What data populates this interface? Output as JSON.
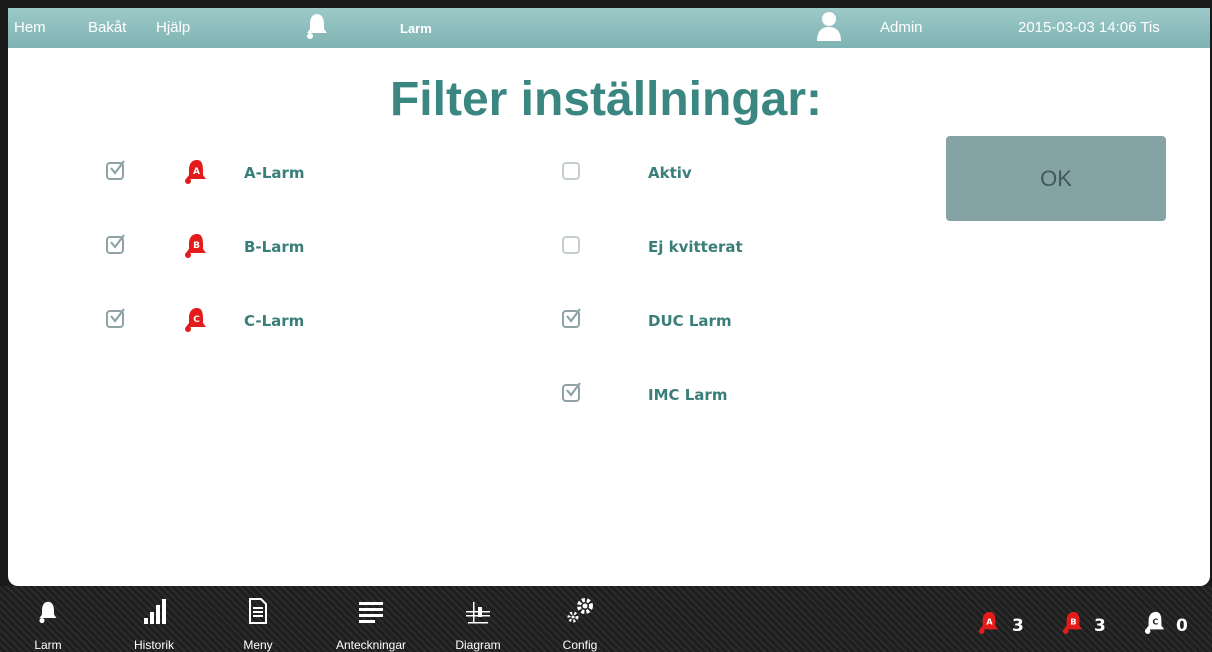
{
  "topbar": {
    "home": "Hem",
    "back": "Bakåt",
    "help": "Hjälp",
    "current": "Larm",
    "user": "Admin",
    "datetime": "2015-03-03 14:06 Tis"
  },
  "page": {
    "title": "Filter inställningar:"
  },
  "left_filters": [
    {
      "label": "A-Larm",
      "badge": "A",
      "checked": true
    },
    {
      "label": "B-Larm",
      "badge": "B",
      "checked": true
    },
    {
      "label": "C-Larm",
      "badge": "C",
      "checked": true
    }
  ],
  "right_filters": [
    {
      "label": "Aktiv",
      "checked": false
    },
    {
      "label": "Ej kvitterat",
      "checked": false
    },
    {
      "label": "DUC Larm",
      "checked": true
    },
    {
      "label": "IMC Larm",
      "checked": true
    }
  ],
  "ok_label": "OK",
  "bottom_nav": [
    {
      "label": "Larm",
      "icon": "bell-icon"
    },
    {
      "label": "Historik",
      "icon": "bar-chart-icon"
    },
    {
      "label": "Meny",
      "icon": "document-icon"
    },
    {
      "label": "Anteckningar",
      "icon": "notes-icon"
    },
    {
      "label": "Diagram",
      "icon": "diagram-icon"
    },
    {
      "label": "Config",
      "icon": "gears-icon"
    }
  ],
  "alarm_counts": [
    {
      "badge": "A",
      "count": "3",
      "color": "#e31b1b"
    },
    {
      "badge": "B",
      "count": "3",
      "color": "#e31b1b"
    },
    {
      "badge": "C",
      "count": "0",
      "color": "#ffffff"
    }
  ],
  "colors": {
    "accent": "#3a8680",
    "alarm": "#e31b1b",
    "topbar": "#8fbfbe"
  }
}
